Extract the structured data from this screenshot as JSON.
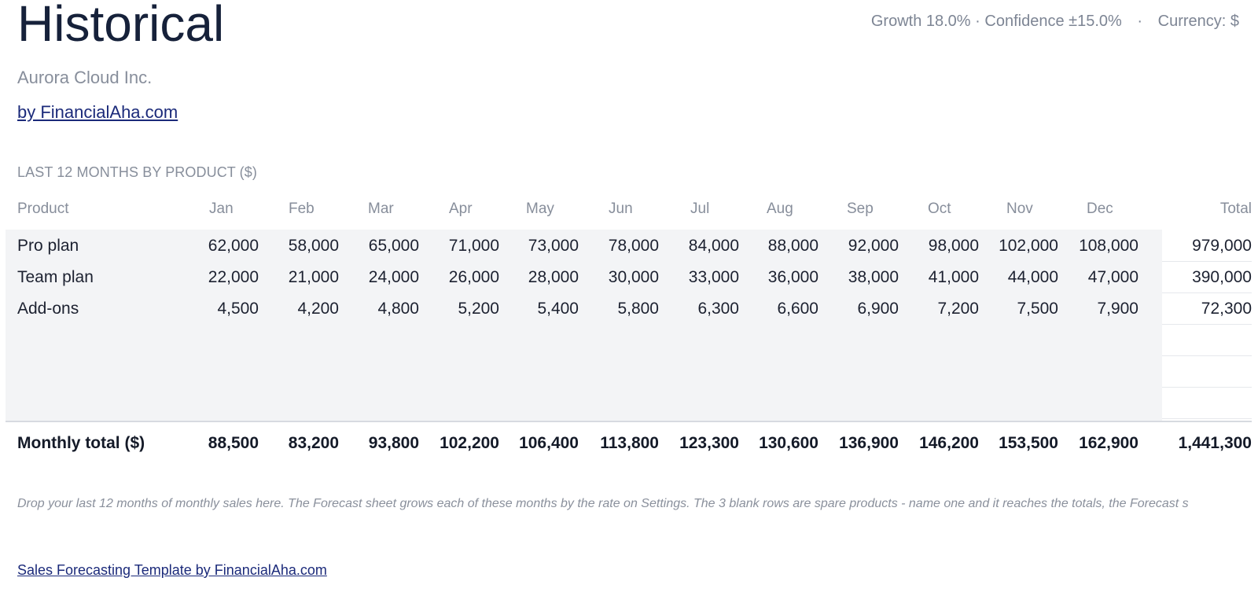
{
  "page": {
    "title": "Historical",
    "company": "Aurora Cloud Inc.",
    "byline": "by FinancialAha.com"
  },
  "meta": {
    "growth": "Growth 18.0%",
    "sep1": "·",
    "confidence": "Confidence ±15.0%",
    "sep2": "·",
    "currency": "Currency: $"
  },
  "section": {
    "heading": "LAST 12 MONTHS BY PRODUCT ($)"
  },
  "table": {
    "product_header": "Product",
    "total_header": "Total",
    "months": [
      "Jan",
      "Feb",
      "Mar",
      "Apr",
      "May",
      "Jun",
      "Jul",
      "Aug",
      "Sep",
      "Oct",
      "Nov",
      "Dec"
    ],
    "rows": [
      {
        "product": "Pro plan",
        "values": [
          "62,000",
          "58,000",
          "65,000",
          "71,000",
          "73,000",
          "78,000",
          "84,000",
          "88,000",
          "92,000",
          "98,000",
          "102,000",
          "108,000"
        ],
        "total": "979,000"
      },
      {
        "product": "Team plan",
        "values": [
          "22,000",
          "21,000",
          "24,000",
          "26,000",
          "28,000",
          "30,000",
          "33,000",
          "36,000",
          "38,000",
          "41,000",
          "44,000",
          "47,000"
        ],
        "total": "390,000"
      },
      {
        "product": "Add-ons",
        "values": [
          "4,500",
          "4,200",
          "4,800",
          "5,200",
          "5,400",
          "5,800",
          "6,300",
          "6,600",
          "6,900",
          "7,200",
          "7,500",
          "7,900"
        ],
        "total": "72,300"
      },
      {
        "product": "",
        "values": [
          "",
          "",
          "",
          "",
          "",
          "",
          "",
          "",
          "",
          "",
          "",
          ""
        ],
        "total": ""
      },
      {
        "product": "",
        "values": [
          "",
          "",
          "",
          "",
          "",
          "",
          "",
          "",
          "",
          "",
          "",
          ""
        ],
        "total": ""
      },
      {
        "product": "",
        "values": [
          "",
          "",
          "",
          "",
          "",
          "",
          "",
          "",
          "",
          "",
          "",
          ""
        ],
        "total": ""
      }
    ],
    "totals": {
      "label": "Monthly total ($)",
      "values": [
        "88,500",
        "83,200",
        "93,800",
        "102,200",
        "106,400",
        "113,800",
        "123,300",
        "130,600",
        "136,900",
        "146,200",
        "153,500",
        "162,900"
      ],
      "total": "1,441,300"
    }
  },
  "note": "Drop your last 12 months of monthly sales here. The Forecast sheet grows each of these months by the rate on Settings. The 3 blank rows are spare products - name one and it reaches the totals, the Forecast s",
  "footer": {
    "link": "Sales Forecasting Template by FinancialAha.com"
  }
}
